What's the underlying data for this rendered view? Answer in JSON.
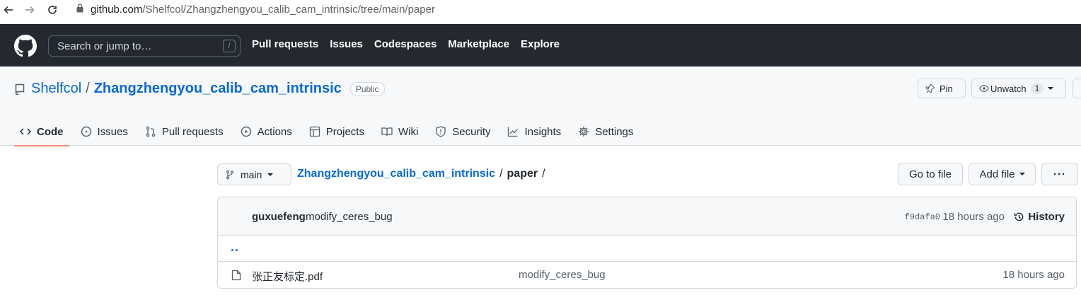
{
  "browser": {
    "url_host": "github.com",
    "url_path": "/Shelfcol/Zhangzhengyou_calib_cam_intrinsic/tree/main/paper"
  },
  "header": {
    "search_placeholder": "Search or jump to…",
    "search_key": "/",
    "nav": [
      "Pull requests",
      "Issues",
      "Codespaces",
      "Marketplace",
      "Explore"
    ]
  },
  "repo": {
    "owner": "Shelfcol",
    "separator": "/",
    "name": "Zhangzhengyou_calib_cam_intrinsic",
    "visibility": "Public",
    "pin_label": "Pin",
    "unwatch_label": "Unwatch",
    "watch_count": "1"
  },
  "tabs": [
    {
      "label": "Code",
      "icon": "code-icon"
    },
    {
      "label": "Issues",
      "icon": "issue-icon"
    },
    {
      "label": "Pull requests",
      "icon": "pull-request-icon"
    },
    {
      "label": "Actions",
      "icon": "play-icon"
    },
    {
      "label": "Projects",
      "icon": "table-icon"
    },
    {
      "label": "Wiki",
      "icon": "book-icon"
    },
    {
      "label": "Security",
      "icon": "shield-icon"
    },
    {
      "label": "Insights",
      "icon": "graph-icon"
    },
    {
      "label": "Settings",
      "icon": "gear-icon"
    }
  ],
  "toolbar": {
    "branch": "main",
    "breadcrumb_repo": "Zhangzhengyou_calib_cam_intrinsic",
    "breadcrumb_sep": "/",
    "breadcrumb_current": "paper",
    "breadcrumb_trail": "/",
    "goto_file": "Go to file",
    "add_file": "Add file",
    "more": "···"
  },
  "commit": {
    "author": "guxuefeng",
    "message": "modify_ceres_bug",
    "sha": "f9dafa0",
    "time": "18 hours ago",
    "history_label": "History"
  },
  "files": {
    "parent": "..",
    "items": [
      {
        "name": "张正友标定.pdf",
        "commit": "modify_ceres_bug",
        "time": "18 hours ago"
      }
    ]
  },
  "colors": {
    "header_bg": "#24292f",
    "link": "#0969da",
    "active_tab_underline": "#fd8c73"
  }
}
